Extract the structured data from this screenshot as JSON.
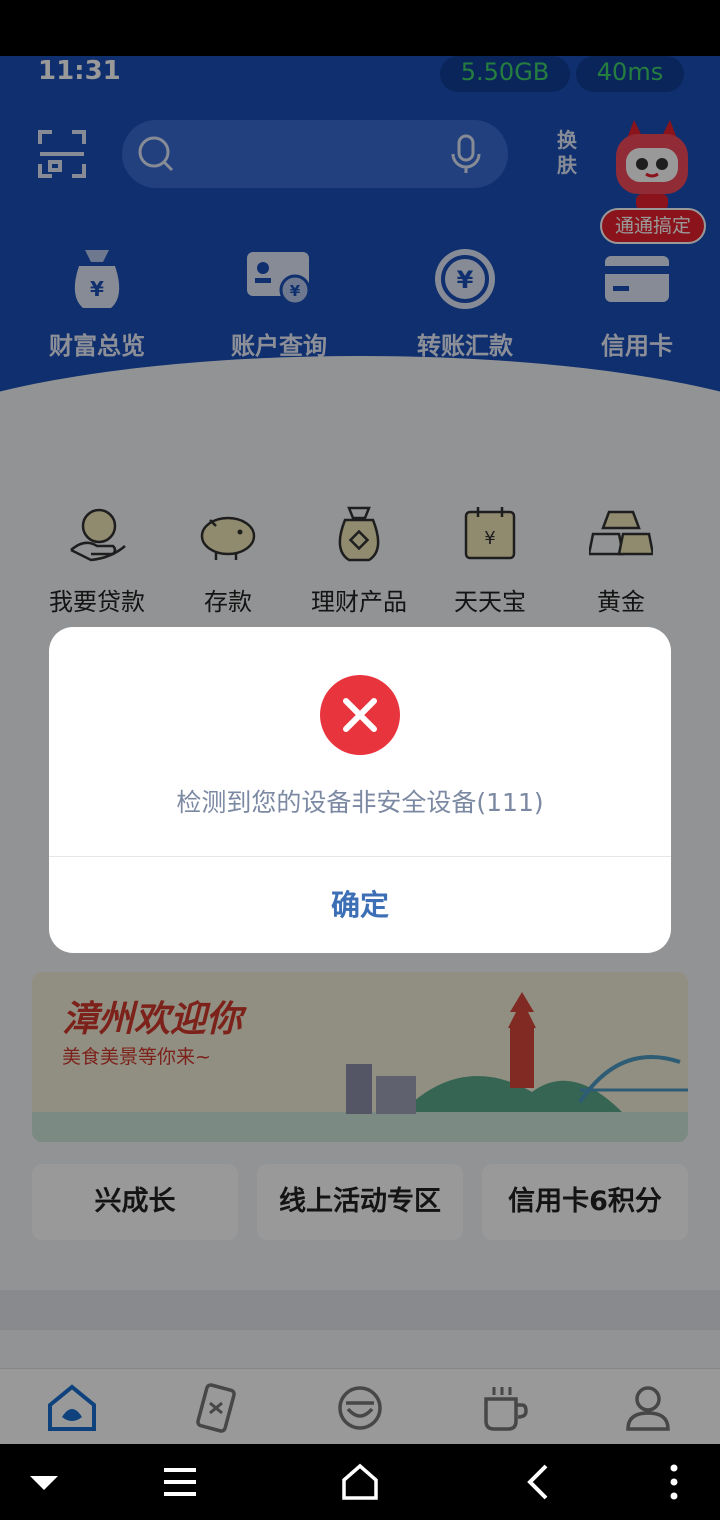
{
  "status_bar": {
    "time": "11:31",
    "data_usage": "5.50GB",
    "latency": "40ms"
  },
  "header": {
    "search_placeholder": "",
    "skin_label_top": "换",
    "skin_label_bottom": "肤",
    "assistant_badge": "通通搞定"
  },
  "quick_actions": [
    {
      "label": "财富总览",
      "icon": "money-bag-icon"
    },
    {
      "label": "账户查询",
      "icon": "account-card-icon"
    },
    {
      "label": "转账汇款",
      "icon": "transfer-icon"
    },
    {
      "label": "信用卡",
      "icon": "credit-card-icon"
    }
  ],
  "services": [
    {
      "label": "我要贷款",
      "icon": "loan-icon"
    },
    {
      "label": "存款",
      "icon": "piggy-bank-icon"
    },
    {
      "label": "理财产品",
      "icon": "wealth-product-icon"
    },
    {
      "label": "天天宝",
      "icon": "calendar-yuan-icon"
    },
    {
      "label": "黄金",
      "icon": "gold-bars-icon"
    }
  ],
  "banner": {
    "title": "漳州欢迎你",
    "subtitle": "美食美景等你来~"
  },
  "promo_cards": [
    "兴成长",
    "线上活动专区",
    "信用卡6积分"
  ],
  "tabs": [
    {
      "icon": "home-icon"
    },
    {
      "icon": "wealth-icon"
    },
    {
      "icon": "discover-icon"
    },
    {
      "icon": "life-icon"
    },
    {
      "icon": "profile-icon"
    }
  ],
  "dialog": {
    "message": "检测到您的设备非安全设备(111)",
    "confirm_label": "确定"
  },
  "colors": {
    "brand_blue": "#1a4fb8",
    "error_red": "#e8343d",
    "confirm_blue": "#3c6fb5"
  }
}
